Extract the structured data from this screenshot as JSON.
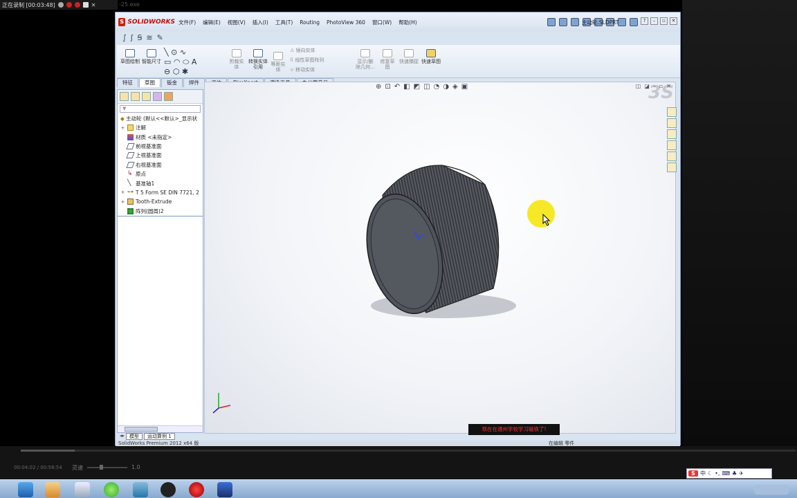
{
  "recorder": {
    "title": "正在录制 [00:03:48]"
  },
  "background_window": {
    "title": "-25.exe"
  },
  "app": {
    "logo_text": "SOLIDWORKS",
    "doc_title": "主动轮.SLDPRT"
  },
  "menu": [
    "文件(F)",
    "编辑(E)",
    "视图(V)",
    "插入(I)",
    "工具(T)",
    "Routing",
    "PhotoView 360",
    "窗口(W)",
    "帮助(H)"
  ],
  "commands": [
    {
      "label": "草图绘制",
      "enabled": true
    },
    {
      "label": "智能尺寸",
      "enabled": true
    },
    {
      "label": "剪裁实体",
      "enabled": false
    },
    {
      "label": "转换实体引用",
      "enabled": true
    },
    {
      "label": "等距实体",
      "enabled": false
    },
    {
      "label": "镜向实体",
      "enabled": false
    },
    {
      "label": "线性草图阵列",
      "enabled": false
    },
    {
      "label": "移动实体",
      "enabled": false
    },
    {
      "label": "显示/删除几何...",
      "enabled": false
    },
    {
      "label": "修复草图",
      "enabled": false
    },
    {
      "label": "快速捕捉",
      "enabled": false
    },
    {
      "label": "快速草图",
      "enabled": true
    }
  ],
  "tabs": [
    "特征",
    "草图",
    "钣金",
    "焊件",
    "评估",
    "DimXpert",
    "渲染工具",
    "办公室产品"
  ],
  "active_tab": "草图",
  "feature_tree": {
    "root": "主动轮 (默认<<默认>_显示状",
    "items": [
      "注解",
      "材质 <未指定>",
      "前视基准面",
      "上视基准面",
      "右视基准面",
      "原点",
      "基准轴1",
      "T 5 Form SE DIN 7721, 2",
      "Tooth-Extrude",
      "阵列(圆周)2"
    ]
  },
  "viewport": {
    "notice": "现在在通州学校学习磁铁了!",
    "watermark": "3S"
  },
  "sheet_tabs": [
    "模型",
    "运动算例 1"
  ],
  "statusbar": {
    "left": "SolidWorks Premium 2012 x64 版",
    "right": "在编辑 零件"
  },
  "player": {
    "time": "00:04:02 / 00:58:54",
    "speed_label": "灵速",
    "speed_value": "1.0",
    "progress": 0.07
  },
  "ime": {
    "logo": "S",
    "label": "中"
  },
  "icons": [
    "solidworks-logo-icon",
    "yellow-cursor-highlight",
    "windows-start-icon",
    "ie-icon",
    "media-player-icon",
    "explorer-icon",
    "360-icon",
    "feather-icon",
    "recorder-icon",
    "film-icon"
  ]
}
